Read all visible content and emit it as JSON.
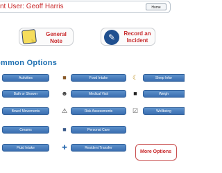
{
  "header": {
    "title": "nt User: Geoff Harris",
    "home_label": "Home"
  },
  "actions": {
    "general_note": "General Note",
    "record_incident": "Record an Incident"
  },
  "section": {
    "title": "ommon Options"
  },
  "options": {
    "col1": [
      "Activities",
      "Bath or Shower",
      "Bowel Movements",
      "Creams",
      "Fluid Intake"
    ],
    "col2": [
      "Food Intake",
      "Medical Visit",
      "Risk Assessments",
      "Personal Care",
      "Resident Transfer"
    ],
    "col3": [
      "Sleep Infor",
      "Weigh",
      "Wellbeing"
    ]
  },
  "more": {
    "label": "More Options"
  },
  "colors": {
    "accent_red": "#c8282a",
    "button_blue": "#3a6eb0",
    "section_blue": "#1d6fb1"
  }
}
